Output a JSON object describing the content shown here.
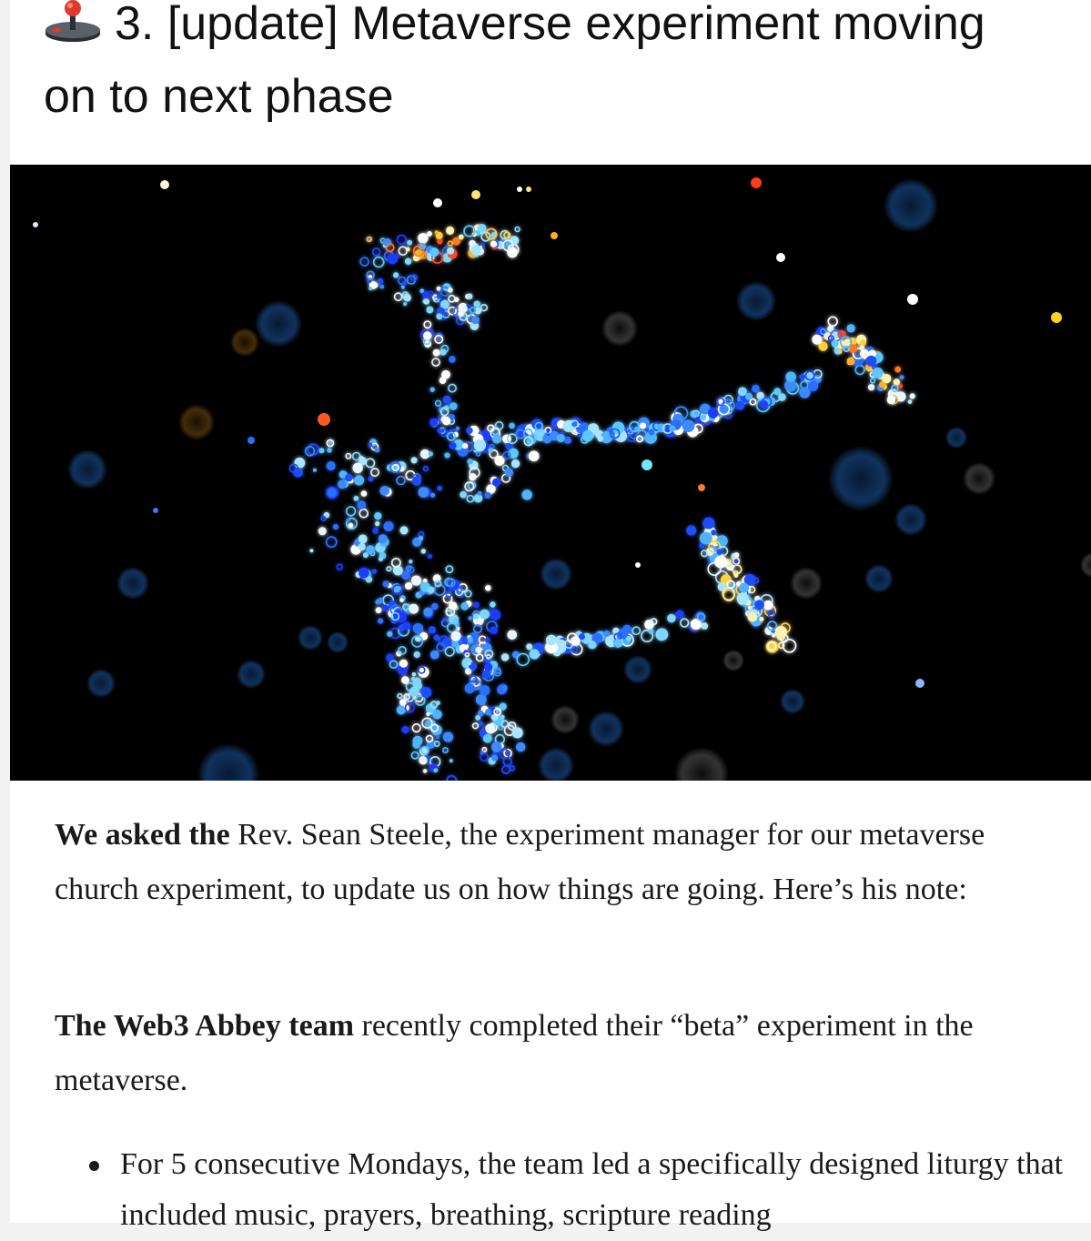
{
  "article": {
    "heading_icon": "joystick-icon",
    "heading_line1": "3. [update] Metaverse experiment moving",
    "heading_line2": "on to next phase",
    "hero_image": {
      "description_icon": "particle-figure-image"
    },
    "paragraph1": {
      "lead": "We asked the",
      "rest": " Rev. Sean Steele, the experiment manager for our metaverse church experiment, to update us on how things are going. Here’s his note:"
    },
    "paragraph2": {
      "lead": "The Web3 Abbey team",
      "rest": " recently completed their “beta” experiment in the metaverse."
    },
    "bullets": [
      "For 5 consecutive Mondays, the team led a specifically designed liturgy that included music, prayers, breathing, scripture reading"
    ]
  },
  "colors": {
    "page_bg": "#ffffff",
    "gutter_bg": "#f2f2f2",
    "text": "#1a1a1a",
    "hero_bg": "#000000"
  }
}
